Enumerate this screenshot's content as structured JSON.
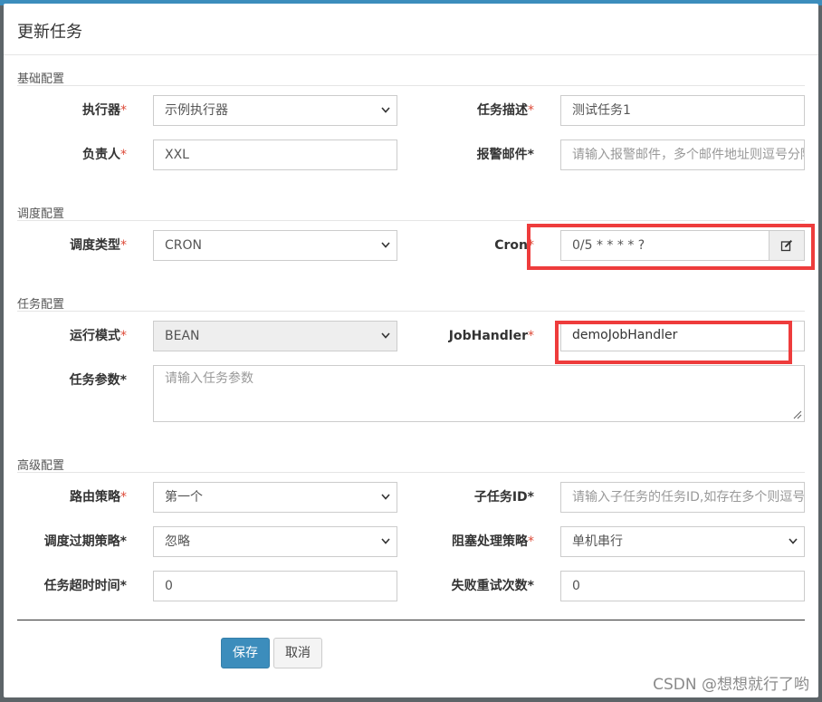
{
  "dialog": {
    "title": "更新任务"
  },
  "sections": {
    "basic": "基础配置",
    "schedule": "调度配置",
    "task": "任务配置",
    "advanced": "高级配置"
  },
  "required_mark": "*",
  "fields": {
    "executor": {
      "label": "执行器",
      "value": "示例执行器"
    },
    "job_desc": {
      "label": "任务描述",
      "value": "测试任务1"
    },
    "author": {
      "label": "负责人",
      "value": "XXL"
    },
    "alarm_email": {
      "label": "报警邮件",
      "placeholder": "请输入报警邮件，多个邮件地址则逗号分隔"
    },
    "schedule_type": {
      "label": "调度类型",
      "value": "CRON"
    },
    "cron": {
      "label": "Cron",
      "value": "0/5 * * * * ?"
    },
    "glue_type": {
      "label": "运行模式",
      "value": "BEAN"
    },
    "job_handler": {
      "label": "JobHandler",
      "value": "demoJobHandler"
    },
    "job_param": {
      "label": "任务参数",
      "placeholder": "请输入任务参数"
    },
    "route_strategy": {
      "label": "路由策略",
      "value": "第一个"
    },
    "child_job_id": {
      "label": "子任务ID",
      "placeholder": "请输入子任务的任务ID,如存在多个则逗号分隔"
    },
    "misfire_strategy": {
      "label": "调度过期策略",
      "value": "忽略"
    },
    "block_strategy": {
      "label": "阻塞处理策略",
      "value": "单机串行"
    },
    "timeout": {
      "label": "任务超时时间",
      "value": "0"
    },
    "fail_retry": {
      "label": "失败重试次数",
      "value": "0"
    }
  },
  "buttons": {
    "save": "保存",
    "cancel": "取消"
  },
  "colors": {
    "primary": "#3c8dbc",
    "required": "#dd4b39",
    "highlight": "#ee3c3c"
  },
  "icons": {
    "select": "chevron-down-icon",
    "cron_edit": "edit-icon"
  },
  "watermark": "CSDN @想想就行了哟"
}
